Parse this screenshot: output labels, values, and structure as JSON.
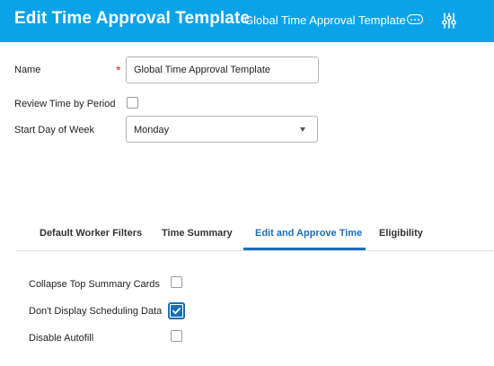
{
  "header": {
    "title": "Edit Time Approval Template",
    "subtitle": "Global Time Approval Template",
    "more_icon": "ellipsis-icon",
    "settings_icon": "settings-sliders-icon"
  },
  "form": {
    "name_label": "Name",
    "required_marker": "*",
    "name_value": "Global Time Approval Template",
    "review_label": "Review Time by Period",
    "review_checked": false,
    "start_day_label": "Start Day of Week",
    "start_day_value": "Monday"
  },
  "tabs": [
    {
      "label": "Default Worker Filters",
      "active": false
    },
    {
      "label": "Time Summary",
      "active": false
    },
    {
      "label": "Edit and Approve Time",
      "active": true
    },
    {
      "label": "Eligibility",
      "active": false
    }
  ],
  "options": [
    {
      "label": "Collapse Top Summary Cards",
      "checked": false
    },
    {
      "label": "Don't Display Scheduling Data",
      "checked": true
    },
    {
      "label": "Disable Autofill",
      "checked": false
    }
  ],
  "colors": {
    "header_bg": "#0ba3e8",
    "accent": "#1b6fb8",
    "required": "#d9281c"
  }
}
